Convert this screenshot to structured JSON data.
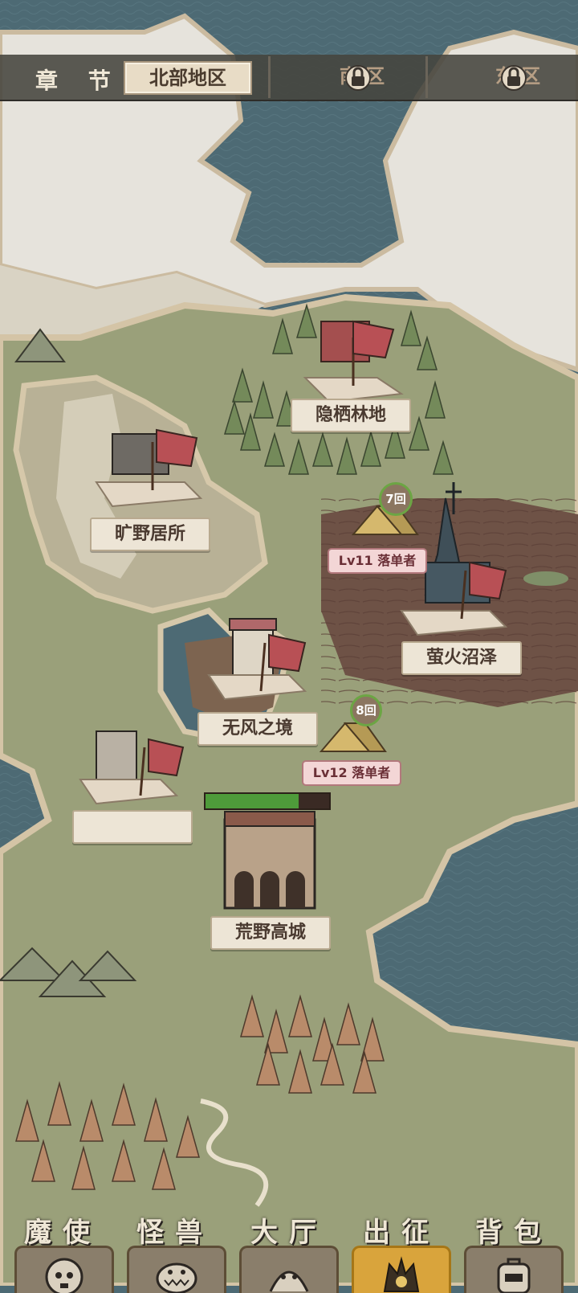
{
  "header": {
    "chapter_label": "章 节",
    "tabs": [
      {
        "label": "北部地区",
        "locked": false
      },
      {
        "label": "南    区",
        "locked": true
      },
      {
        "label": "东    区",
        "locked": true
      }
    ]
  },
  "map": {
    "locations": [
      {
        "name": "隐栖林地"
      },
      {
        "name": "旷野居所"
      },
      {
        "name": "萤火沼泽"
      },
      {
        "name": "无风之境"
      },
      {
        "name": "荒野高城"
      }
    ],
    "enemies": [
      {
        "label": "Lv11 落单者",
        "turns": "7回"
      },
      {
        "label": "Lv12 落单者",
        "turns": "8回"
      }
    ],
    "city_health": 0.75
  },
  "nav": {
    "items": [
      {
        "label": "魔使",
        "icon": "skull-icon",
        "active": false
      },
      {
        "label": "怪兽",
        "icon": "monster-icon",
        "active": false
      },
      {
        "label": "大厅",
        "icon": "hall-icon",
        "active": false
      },
      {
        "label": "出征",
        "icon": "expedition-icon",
        "active": true
      },
      {
        "label": "背包",
        "icon": "backpack-icon",
        "active": false
      }
    ]
  },
  "colors": {
    "water": "#4d6a74",
    "snow": "#e9e6df",
    "grass": "#9aa07a",
    "swamp": "#6e5246",
    "active_tab": "#d9a43c",
    "hp_green": "#4e9b3a"
  }
}
